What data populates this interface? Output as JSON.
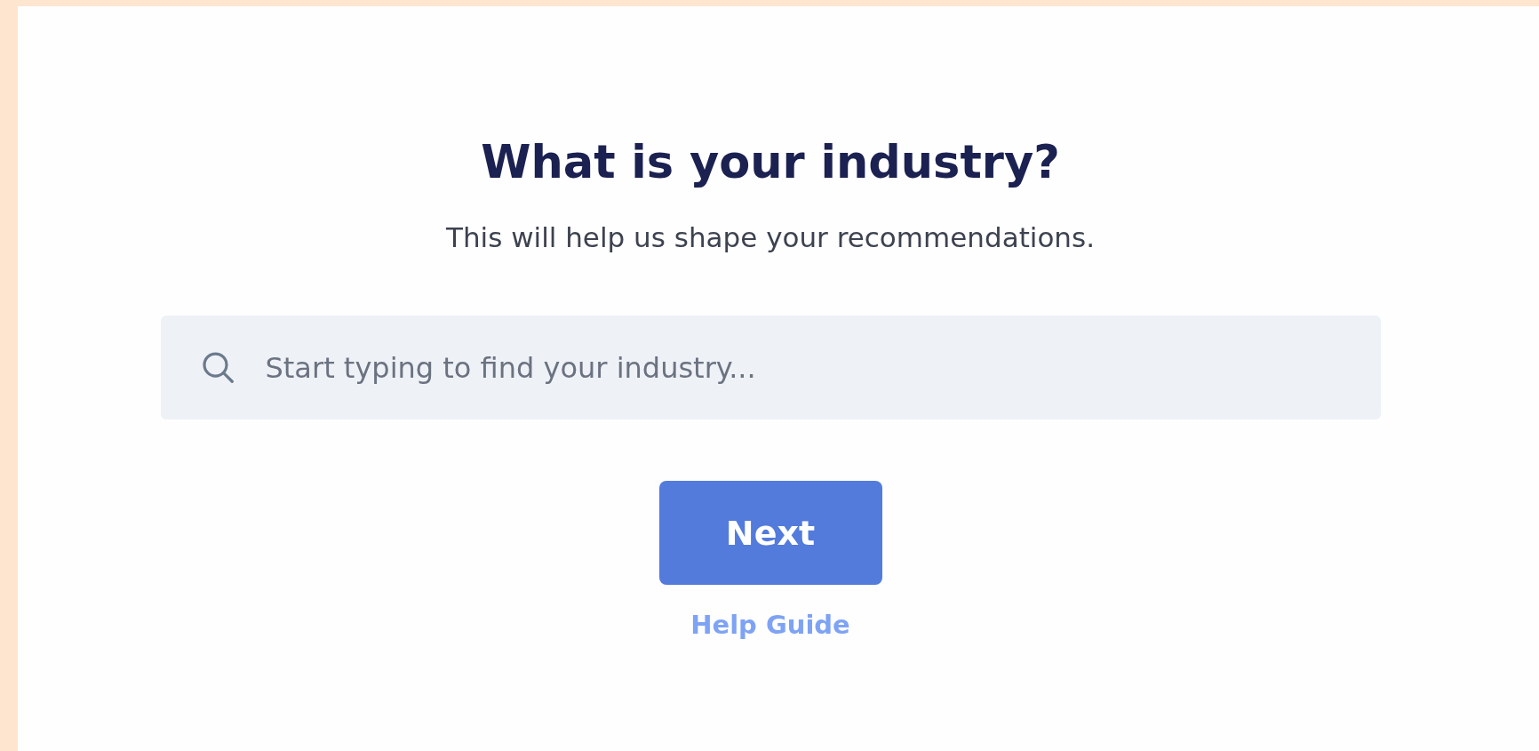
{
  "title": "What is your industry?",
  "subtitle": "This will help us shape your recommendations.",
  "search": {
    "placeholder": "Start typing to find your industry..."
  },
  "buttons": [
    {
      "label": "Next",
      "kind": "primary"
    }
  ],
  "links": [
    {
      "label": "Help Guide"
    }
  ]
}
